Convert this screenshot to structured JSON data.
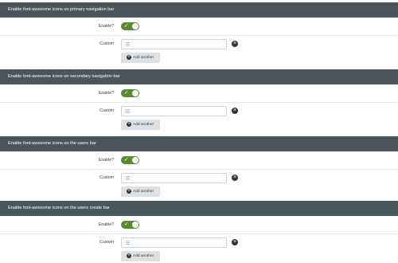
{
  "sections": [
    {
      "title": "Enable font-awesome icons on primary navigation bar",
      "enable_label": "Enable?",
      "enable_checked": true,
      "custom_label": "Custom",
      "custom_value": "",
      "add_label": "Add another"
    },
    {
      "title": "Enable font-awesome icons on secondary navigation bar",
      "enable_label": "Enable?",
      "enable_checked": true,
      "custom_label": "Custom",
      "custom_value": "",
      "add_label": "Add another"
    },
    {
      "title": "Enable font-awesome icons on the users bar",
      "enable_label": "Enable?",
      "enable_checked": true,
      "custom_label": "Custom",
      "custom_value": "",
      "add_label": "Add another"
    },
    {
      "title": "Enable font-awesome icons on the users create bar",
      "enable_label": "Enable?",
      "enable_checked": true,
      "custom_label": "Custom",
      "custom_value": "",
      "add_label": "Add another"
    }
  ],
  "icons": {
    "toggle_check": "check-icon",
    "input_icon": "bars-icon",
    "remove": "close-circle-icon",
    "add": "plus-circle-icon"
  },
  "colors": {
    "header_bg": "#4a565c",
    "toggle_on": "#5b8a33",
    "button_bg": "#dee1e3"
  }
}
